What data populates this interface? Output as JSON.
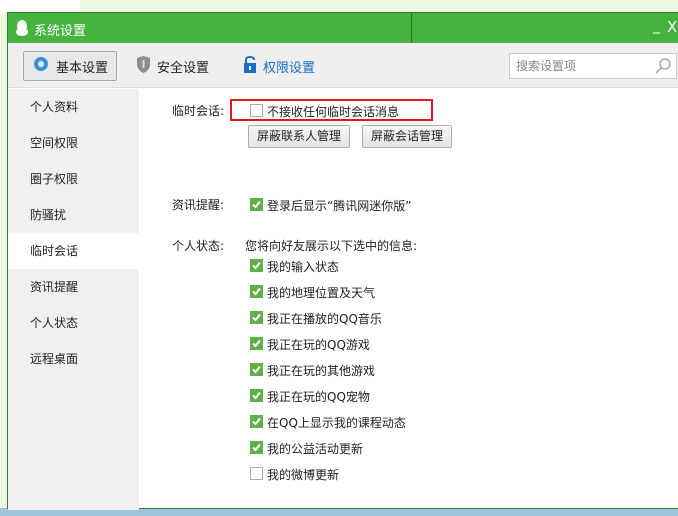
{
  "window": {
    "title": "系统设置",
    "minimize": "_",
    "close": "X"
  },
  "toolbar": {
    "tabs": [
      {
        "label": "基本设置",
        "icon": "gear-icon"
      },
      {
        "label": "安全设置",
        "icon": "shield-icon"
      },
      {
        "label": "权限设置",
        "icon": "lock-icon"
      }
    ],
    "search_placeholder": "搜索设置项"
  },
  "sidebar": {
    "items": [
      "个人资料",
      "空间权限",
      "圈子权限",
      "防骚扰",
      "临时会话",
      "资讯提醒",
      "个人状态",
      "远程桌面"
    ],
    "selected": "临时会话"
  },
  "temp_chat": {
    "label": "临时会话:",
    "option": {
      "label": "不接收任何临时会话消息",
      "checked": false
    },
    "buttons": [
      "屏蔽联系人管理",
      "屏蔽会话管理"
    ]
  },
  "news": {
    "label": "资讯提醒:",
    "option": {
      "label": "登录后显示“腾讯网迷你版”",
      "checked": true
    }
  },
  "status": {
    "label": "个人状态:",
    "desc": "您将向好友展示以下选中的信息:",
    "options": [
      {
        "label": "我的输入状态",
        "checked": true
      },
      {
        "label": "我的地理位置及天气",
        "checked": true
      },
      {
        "label": "我正在播放的QQ音乐",
        "checked": true
      },
      {
        "label": "我正在玩的QQ游戏",
        "checked": true
      },
      {
        "label": "我正在玩的其他游戏",
        "checked": true
      },
      {
        "label": "我正在玩的QQ宠物",
        "checked": true
      },
      {
        "label": "在QQ上显示我的课程动态",
        "checked": true
      },
      {
        "label": "我的公益活动更新",
        "checked": true
      },
      {
        "label": "我的微博更新",
        "checked": false
      }
    ]
  },
  "colors": {
    "titlebar": "#45b33e",
    "check": "#5fb048",
    "highlight": "#e01818",
    "link": "#1a6fc3"
  }
}
